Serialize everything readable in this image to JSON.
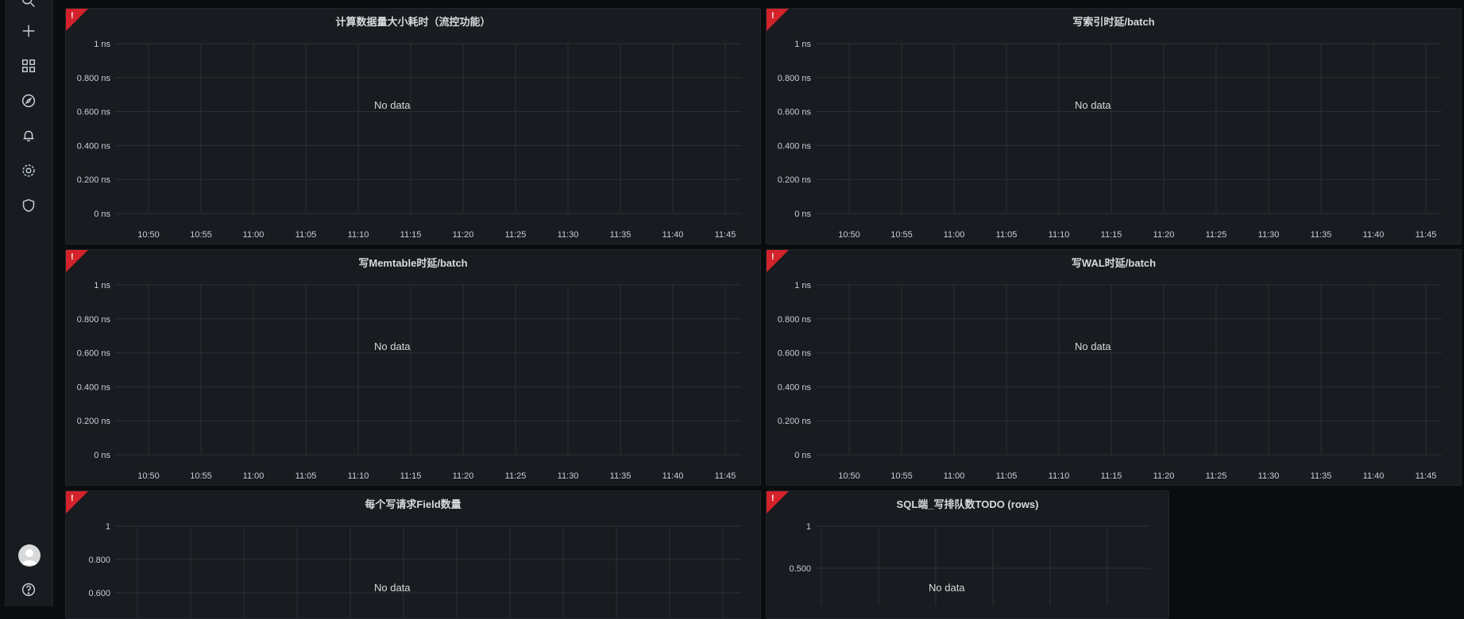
{
  "sidebar": {
    "icons": [
      "search-icon",
      "plus-icon",
      "dashboards-icon",
      "explore-icon",
      "alerting-icon",
      "settings-icon",
      "shield-icon"
    ],
    "bottom": [
      "avatar",
      "help-icon"
    ]
  },
  "panels": [
    {
      "title": "计算数据量大小耗时（流控功能）",
      "no_data": "No data",
      "alert_mark": "!"
    },
    {
      "title": "写索引时延/batch",
      "no_data": "No data",
      "alert_mark": "!"
    },
    {
      "title": "写Memtable时延/batch",
      "no_data": "No data",
      "alert_mark": "!"
    },
    {
      "title": "写WAL时延/batch",
      "no_data": "No data",
      "alert_mark": "!"
    },
    {
      "title": "每个写请求Field数量",
      "no_data": "No data",
      "alert_mark": "!"
    },
    {
      "title": "SQL端_写排队数TODO (rows)",
      "no_data": "No data",
      "alert_mark": "!"
    }
  ],
  "chart_data": [
    {
      "type": "line",
      "title": "计算数据量大小耗时（流控功能）",
      "y_ticks": [
        "1 ns",
        "0.800 ns",
        "0.600 ns",
        "0.400 ns",
        "0.200 ns",
        "0 ns"
      ],
      "x_ticks": [
        "10:50",
        "10:55",
        "11:00",
        "11:05",
        "11:10",
        "11:15",
        "11:20",
        "11:25",
        "11:30",
        "11:35",
        "11:40",
        "11:45"
      ],
      "ylim": [
        0,
        1
      ],
      "grid": true,
      "series": []
    },
    {
      "type": "line",
      "title": "写索引时延/batch",
      "y_ticks": [
        "1 ns",
        "0.800 ns",
        "0.600 ns",
        "0.400 ns",
        "0.200 ns",
        "0 ns"
      ],
      "x_ticks": [
        "10:50",
        "10:55",
        "11:00",
        "11:05",
        "11:10",
        "11:15",
        "11:20",
        "11:25",
        "11:30",
        "11:35",
        "11:40",
        "11:45"
      ],
      "ylim": [
        0,
        1
      ],
      "grid": true,
      "series": []
    },
    {
      "type": "line",
      "title": "写Memtable时延/batch",
      "y_ticks": [
        "1 ns",
        "0.800 ns",
        "0.600 ns",
        "0.400 ns",
        "0.200 ns",
        "0 ns"
      ],
      "x_ticks": [
        "10:50",
        "10:55",
        "11:00",
        "11:05",
        "11:10",
        "11:15",
        "11:20",
        "11:25",
        "11:30",
        "11:35",
        "11:40",
        "11:45"
      ],
      "ylim": [
        0,
        1
      ],
      "grid": true,
      "series": []
    },
    {
      "type": "line",
      "title": "写WAL时延/batch",
      "y_ticks": [
        "1 ns",
        "0.800 ns",
        "0.600 ns",
        "0.400 ns",
        "0.200 ns",
        "0 ns"
      ],
      "x_ticks": [
        "10:50",
        "10:55",
        "11:00",
        "11:05",
        "11:10",
        "11:15",
        "11:20",
        "11:25",
        "11:30",
        "11:35",
        "11:40",
        "11:45"
      ],
      "ylim": [
        0,
        1
      ],
      "grid": true,
      "series": []
    },
    {
      "type": "line",
      "title": "每个写请求Field数量",
      "y_ticks": [
        "1",
        "0.800",
        "0.600"
      ],
      "x_ticks": [],
      "grid": true,
      "series": []
    },
    {
      "type": "line",
      "title": "SQL端_写排队数TODO (rows)",
      "y_ticks": [
        "1",
        "0.500"
      ],
      "x_ticks": [],
      "grid": true,
      "series": []
    }
  ],
  "colors": {
    "alert": "#d3222b",
    "panel_bg": "#181b1f",
    "page_bg": "#0b0c0e",
    "grid": "#2c3036"
  }
}
